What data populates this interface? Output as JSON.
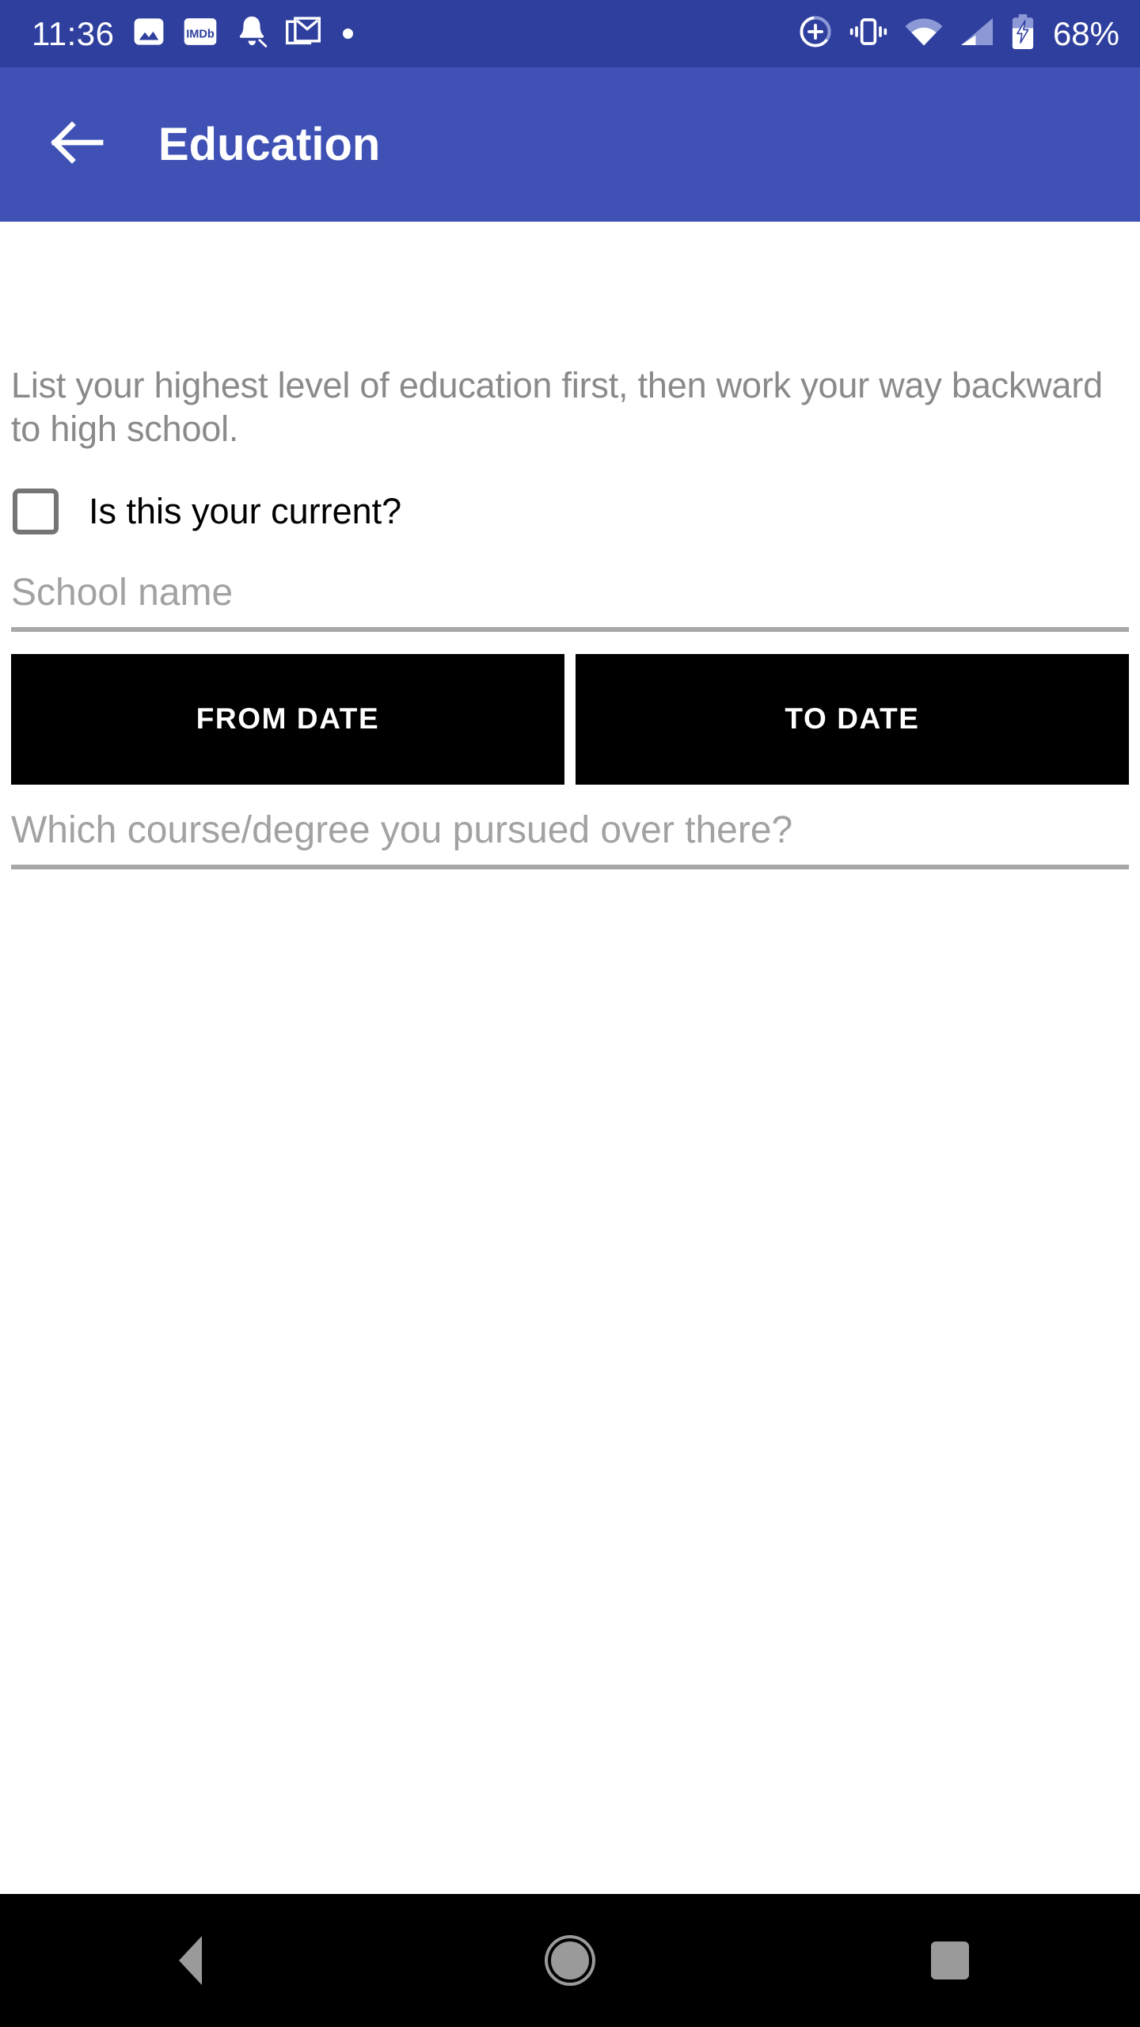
{
  "status_bar": {
    "clock": "11:36",
    "battery_percent": "68%",
    "background_color": "#2F3F9E",
    "left_icons": [
      {
        "name": "photos-icon",
        "label": "Photos"
      },
      {
        "name": "imdb-icon",
        "label": "IMDb"
      },
      {
        "name": "bell-notification-icon",
        "label": "Notification"
      },
      {
        "name": "gmail-icon",
        "label": "Gmail"
      },
      {
        "name": "more-notifications-dot-icon",
        "label": "More"
      }
    ],
    "right_icons": [
      {
        "name": "data-saver-plus-icon",
        "label": "Data saver"
      },
      {
        "name": "vibrate-icon",
        "label": "Vibrate"
      },
      {
        "name": "wifi-icon",
        "label": "Wi-Fi"
      },
      {
        "name": "cellular-signal-icon",
        "label": "Signal"
      },
      {
        "name": "battery-charging-icon",
        "label": "Battery charging"
      }
    ]
  },
  "app_bar": {
    "title": "Education",
    "back_icon": "arrow-back-icon",
    "background_color": "#3F51B5",
    "text_color": "#FFFFFF"
  },
  "form": {
    "hint": "List your highest level of education first, then work your way backward to high school.",
    "current_checkbox": {
      "label": "Is this your current?",
      "checked": false
    },
    "school_name": {
      "placeholder": "School name",
      "value": ""
    },
    "from_date_button": {
      "label": "FROM DATE",
      "background_color": "#000000",
      "text_color": "#FFFFFF"
    },
    "to_date_button": {
      "label": "TO DATE",
      "background_color": "#000000",
      "text_color": "#FFFFFF"
    },
    "course_degree": {
      "placeholder": "Which course/degree you pursued over there?",
      "value": ""
    }
  },
  "nav_bar": {
    "background_color": "#000000",
    "buttons": [
      {
        "name": "nav-back-button",
        "label": "Back"
      },
      {
        "name": "nav-home-button",
        "label": "Home"
      },
      {
        "name": "nav-recents-button",
        "label": "Recents"
      }
    ]
  }
}
